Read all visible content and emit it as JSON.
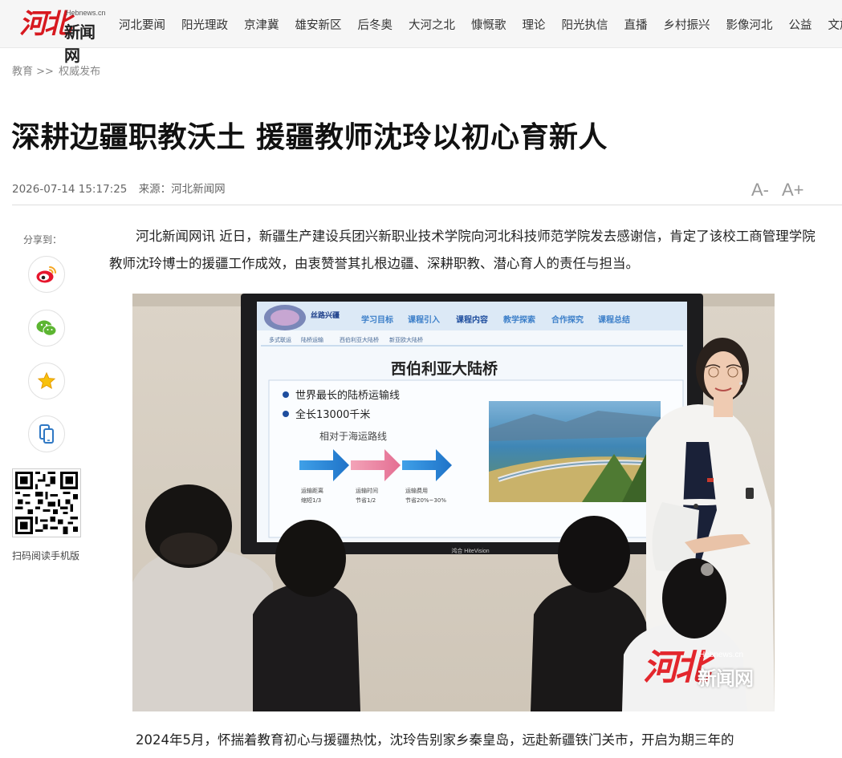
{
  "header": {
    "logo_mark": "河北",
    "logo_site": "Hebnews.cn",
    "logo_name": "新闻网",
    "nav": [
      "河北要闻",
      "阳光理政",
      "京津冀",
      "雄安新区",
      "后冬奥",
      "大河之北",
      "慷慨歌",
      "理论",
      "阳光执信",
      "直播",
      "乡村振兴",
      "影像河北",
      "公益",
      "文旅"
    ]
  },
  "breadcrumb": {
    "section": "教育",
    "sep": ">>",
    "sub": "权威发布"
  },
  "article": {
    "title": "深耕边疆职教沃土 援疆教师沈玲以初心育新人",
    "datetime": "2026-07-14 15:17:25",
    "source": "来源：河北新闻网",
    "font_minus": "A-",
    "font_plus": "A+",
    "para1": "河北新闻网讯 近日，新疆生产建设兵团兴新职业技术学院向河北科技师范学院发去感谢信，肯定了该校工商管理学院教师沈玲博士的援疆工作成效，由衷赞誉其扎根边疆、深耕职教、潜心育人的责任与担当。",
    "para2": "2024年5月，怀揣着教育初心与援疆热忱，沈玲告别家乡秦皇岛，远赴新疆铁门关市，开启为期三年的"
  },
  "share": {
    "label": "分享到：",
    "qr_label": "扫码阅读手机版",
    "icons": [
      "weibo-icon",
      "wechat-icon",
      "star-icon",
      "mobile-icon"
    ]
  },
  "photo": {
    "slide": {
      "logo_text": "丝路兴疆",
      "tabs": [
        "学习目标",
        "课程引入",
        "课程内容",
        "教学探索",
        "合作探究",
        "课程总结"
      ],
      "subtabs": [
        "多式联运",
        "陆桥运输",
        "西伯利亚大陆桥",
        "新亚欧大陆桥"
      ],
      "heading": "西伯利亚大陆桥",
      "bullets": [
        "世界最长的陆桥运输线",
        "全长13000千米"
      ],
      "compare": "相对于海运路线",
      "arrows": [
        {
          "label": "运输距离",
          "value": "缩短1/3"
        },
        {
          "label": "运输时间",
          "value": "节省1/2"
        },
        {
          "label": "运输费用",
          "value": "节省20%~30%"
        }
      ]
    },
    "tv_brand": "鸿合 HiteVision",
    "watermark_mark": "河北",
    "watermark_site": "Hebnews.cn",
    "watermark_name": "新闻网"
  },
  "colors": {
    "brand_red": "#d7191f",
    "accent_blue": "#2f78c4"
  }
}
